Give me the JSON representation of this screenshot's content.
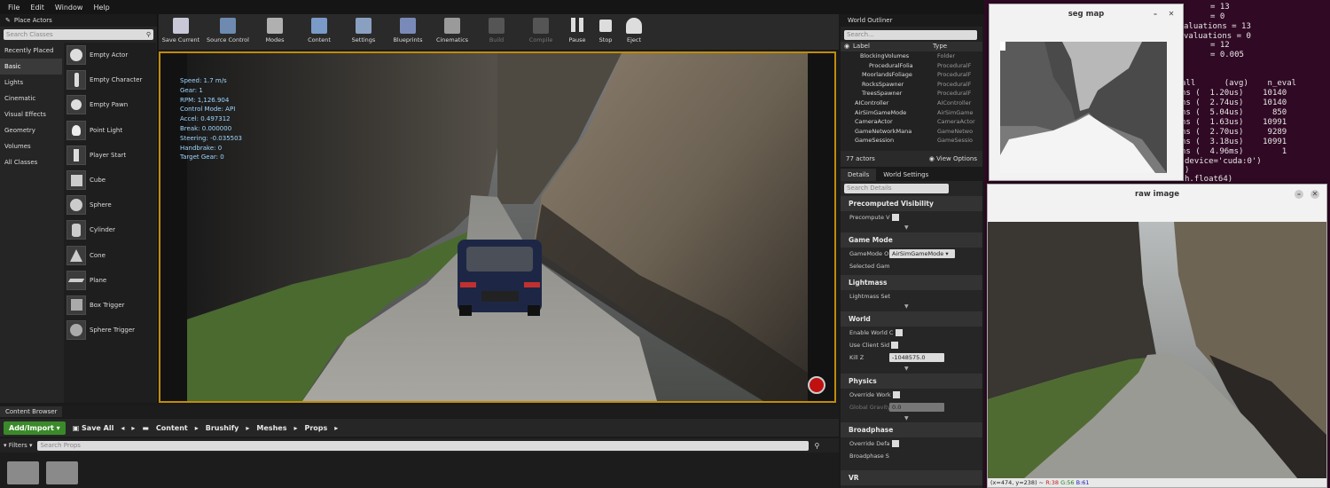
{
  "menu": {
    "items": [
      "File",
      "Edit",
      "Window",
      "Help"
    ]
  },
  "place_actors": {
    "tab": "Place Actors",
    "search_placeholder": "Search Classes",
    "categories": [
      "Recently Placed",
      "Basic",
      "Lights",
      "Cinematic",
      "Visual Effects",
      "Geometry",
      "Volumes",
      "All Classes"
    ],
    "items": [
      "Empty Actor",
      "Empty Character",
      "Empty Pawn",
      "Point Light",
      "Player Start",
      "Cube",
      "Sphere",
      "Cylinder",
      "Cone",
      "Plane",
      "Box Trigger",
      "Sphere Trigger"
    ]
  },
  "toolbar": {
    "buttons": [
      "Save Current",
      "Source Control",
      "Modes",
      "Content",
      "Settings",
      "Blueprints",
      "Cinematics",
      "Build",
      "Compile",
      "Pause",
      "Stop",
      "Eject"
    ]
  },
  "hud": {
    "lines": [
      "Speed: 1.7 m/s",
      "Gear: 1",
      "RPM: 1,126.904",
      "Control Mode: API",
      "Accel: 0.497312",
      "Break: 0.000000",
      "Steering: -0.035503",
      "Handbrake: 0",
      "Target Gear: 0"
    ]
  },
  "content_browser": {
    "tab": "Content Browser",
    "add_import": "Add/Import",
    "save_all": "Save All",
    "path": [
      "Content",
      "Brushify",
      "Meshes",
      "Props"
    ],
    "filters": "Filters",
    "search_placeholder": "Search Props"
  },
  "outliner": {
    "tab": "World Outliner",
    "search_placeholder": "Search...",
    "col_label": "Label",
    "col_type": "Type",
    "rows": [
      {
        "label": "BlockingVolumes",
        "type": "Folder"
      },
      {
        "label": "ProceduralFolia",
        "type": "ProceduralF"
      },
      {
        "label": "MoorlandsFoliage",
        "type": "ProceduralF"
      },
      {
        "label": "RocksSpawner",
        "type": "ProceduralF"
      },
      {
        "label": "TreesSpawner",
        "type": "ProceduralF"
      },
      {
        "label": "AIController",
        "type": "AIController"
      },
      {
        "label": "AirSimGameMode",
        "type": "AirSimGame"
      },
      {
        "label": "CameraActor",
        "type": "CameraActor"
      },
      {
        "label": "GameNetworkMana",
        "type": "GameNetwo"
      },
      {
        "label": "GameSession",
        "type": "GameSessio"
      }
    ],
    "actor_count": "77 actors",
    "view_options": "View Options"
  },
  "details": {
    "tabs": [
      "Details",
      "World Settings"
    ],
    "search_placeholder": "Search Details",
    "sections": {
      "precomputed": "Precomputed Visibility",
      "precompute_row": "Precompute V",
      "gamemode": "Game Mode",
      "gamemode_row": "GameMode O",
      "gamemode_value": "AirSimGameMode",
      "selected_game": "Selected Gam",
      "lightmass": "Lightmass",
      "lightmass_row": "Lightmass Set",
      "world": "World",
      "enable_world": "Enable World C",
      "use_client": "Use Client Sid",
      "killz": "Kill Z",
      "killz_value": "-1048575.0",
      "physics": "Physics",
      "override_world": "Override Work",
      "global_gravity": "Global Gravity",
      "gravity_value": "0.0",
      "broadphase": "Broadphase",
      "override_defa": "Override Defa",
      "broadphase_row": "Broadphase S",
      "vr": "VR"
    }
  },
  "terminal": {
    "lines_top": [
      "= 13",
      "= 0",
      "aluations = 13",
      "valuations = 0",
      "= 12",
      "= 0.005"
    ],
    "table_header": "all      (avg)    n_eval",
    "table_rows": [
      "ns (  1.20us)    10140",
      "ns (  2.74us)    10140",
      "ns (  5.04us)      850",
      "ns (  1.63us)    10991",
      "ns (  2.70us)     9289",
      "ns (  3.18us)    10991",
      "ns (  4.96ms)        1"
    ],
    "device_line": "device='cuda:0')",
    "close_paren": ")",
    "float_line": "h.float64)"
  },
  "seg_window": {
    "title": "seg map"
  },
  "raw_window": {
    "title": "raw image",
    "status_coord": "(x=474, y=238) ~",
    "status_r": "R:38",
    "status_g": "G:56",
    "status_b": "B:61"
  }
}
